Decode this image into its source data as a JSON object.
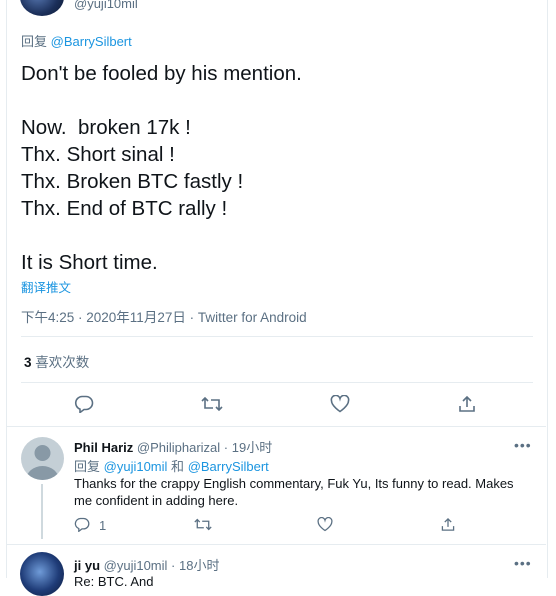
{
  "top_tweet": {
    "handle": "@yuji10mil",
    "reply_prefix": "回复",
    "reply_to": "@BarrySilbert",
    "body": "Don't be fooled by his mention.\n\nNow.  broken 17k !\nThx. Short sinal !\nThx. Broken BTC fastly !\nThx. End of BTC rally !\n\nIt is Short time.",
    "translate": "翻译推文",
    "meta": "下午4:25 · 2020年11月27日 · Twitter for Android",
    "likes_count": "3",
    "likes_label": "喜欢次数"
  },
  "reply": {
    "name": "Phil Hariz",
    "handle": "@Philipharizal",
    "time": "19小时",
    "reply_prefix": "回复",
    "reply_to_1": "@yuji10mil",
    "and": "和",
    "reply_to_2": "@BarrySilbert",
    "body": "Thanks for the crappy English commentary, Fuk Yu, Its funny to read. Makes me confident in adding here.",
    "reply_count": "1",
    "more": "•••"
  },
  "bottom_reply": {
    "name": "ji yu",
    "handle": "@yuji10mil",
    "time": "18小时",
    "more": "•••",
    "body": "Re: BTC. And"
  },
  "icons": [
    "reply-icon",
    "retweet-icon",
    "like-icon",
    "share-icon"
  ],
  "colors": {
    "link": "#1b95e0",
    "secondary": "#5b7083",
    "border": "#e6ecf0"
  }
}
